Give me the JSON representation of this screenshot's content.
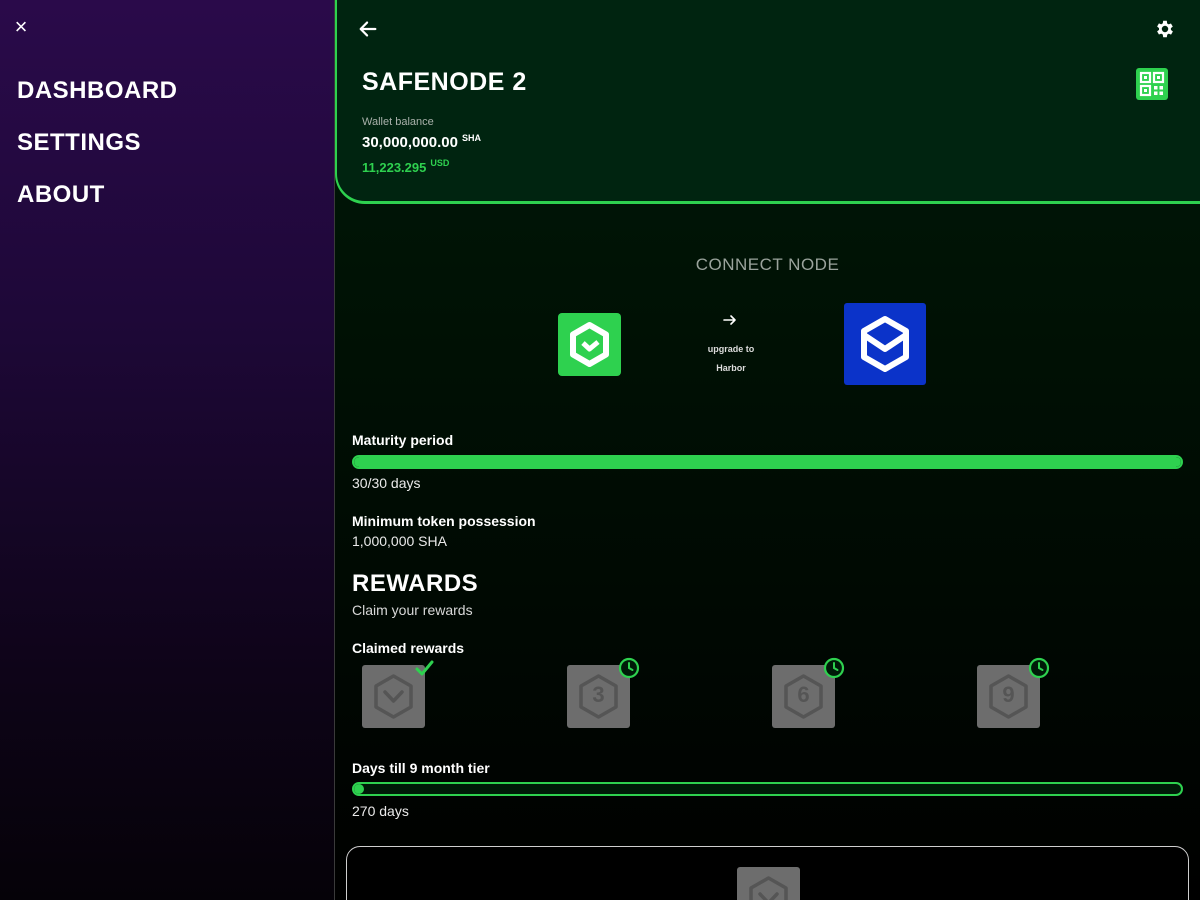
{
  "sidebar": {
    "close_glyph": "×",
    "items": [
      {
        "label": "DASHBOARD"
      },
      {
        "label": "SETTINGS"
      },
      {
        "label": "ABOUT"
      }
    ]
  },
  "header": {
    "title": "SAFENODE 2",
    "wallet_label": "Wallet balance",
    "balance_sha": "30,000,000.00",
    "balance_sha_unit": "SHA",
    "balance_usd": "11,223.295",
    "balance_usd_unit": "USD"
  },
  "connect": {
    "title": "CONNECT NODE",
    "upgrade_line1": "upgrade to",
    "upgrade_line2": "Harbor",
    "from_icon": "safenode-logo-icon",
    "to_icon": "harbor-logo-icon"
  },
  "maturity": {
    "label": "Maturity period",
    "value": "30/30 days",
    "progress": 1.0
  },
  "min_token": {
    "label": "Minimum token possession",
    "value": "1,000,000 SHA"
  },
  "rewards": {
    "title": "REWARDS",
    "subtitle": "Claim your rewards",
    "claimed_label": "Claimed rewards",
    "badges": [
      {
        "number": "",
        "status": "claimed",
        "status_icon": "check-icon"
      },
      {
        "number": "3",
        "status": "pending",
        "status_icon": "clock-icon"
      },
      {
        "number": "6",
        "status": "pending",
        "status_icon": "clock-icon"
      },
      {
        "number": "9",
        "status": "pending",
        "status_icon": "clock-icon"
      }
    ]
  },
  "tier": {
    "label": "Days till 9 month tier",
    "value": "270 days",
    "progress": 0.0
  },
  "colors": {
    "accent": "#2ed14f",
    "harbor_blue": "#0b33c9",
    "badge_grey": "#6d6d6d"
  }
}
